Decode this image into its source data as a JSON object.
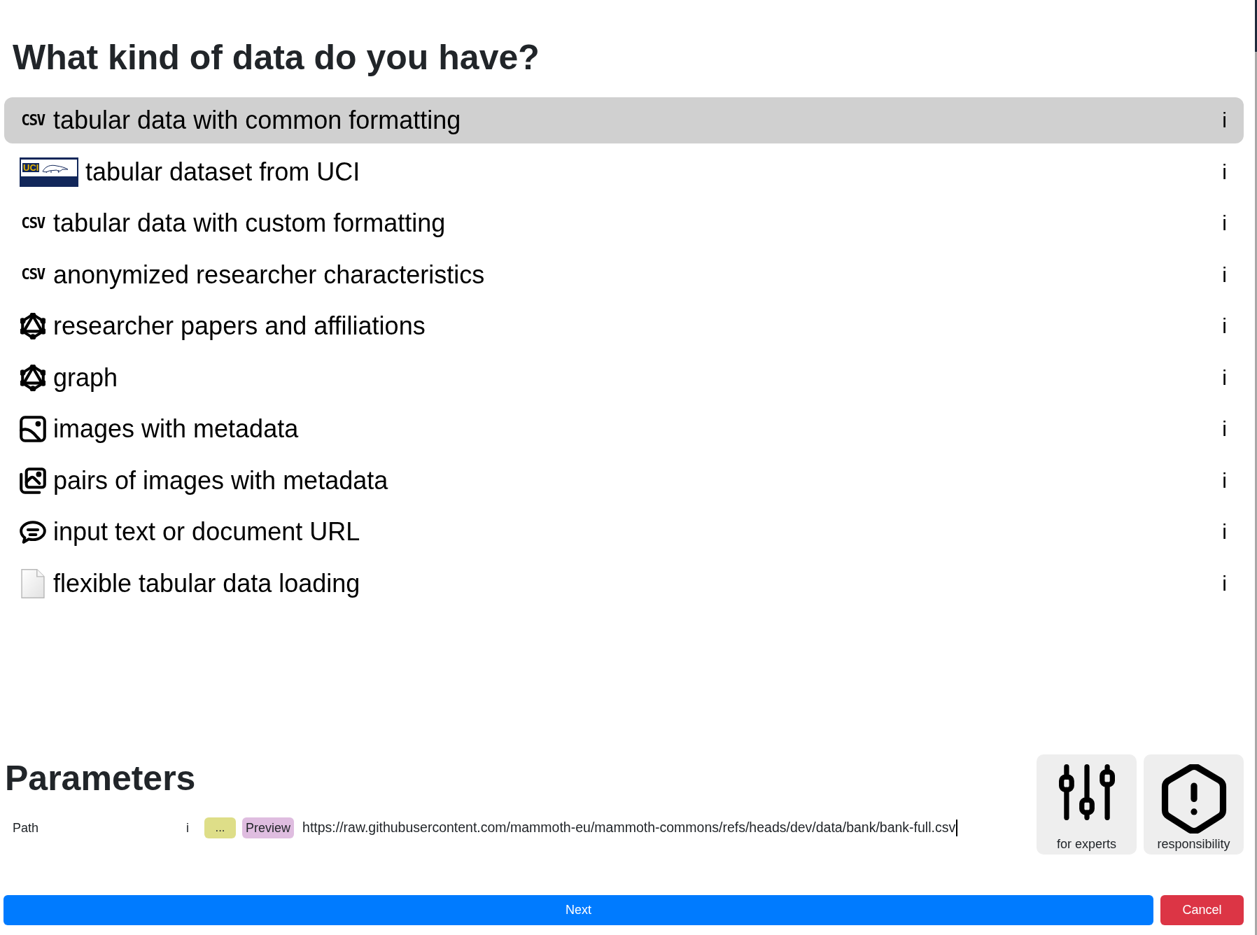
{
  "heading": "What kind of data do you have?",
  "data_types": [
    {
      "kind": "csv",
      "badge": "CSV",
      "label": "tabular data with common formatting",
      "info": "i",
      "selected": true
    },
    {
      "kind": "logo",
      "badge": "UCI",
      "label": "tabular dataset from UCI",
      "info": "i",
      "selected": false
    },
    {
      "kind": "csv",
      "badge": "CSV",
      "label": "tabular data with custom formatting",
      "info": "i",
      "selected": false
    },
    {
      "kind": "csv",
      "badge": "CSV",
      "label": "anonymized researcher characteristics",
      "info": "i",
      "selected": false
    },
    {
      "kind": "graph",
      "label": "researcher papers and affiliations",
      "info": "i",
      "selected": false
    },
    {
      "kind": "graph",
      "label": "graph",
      "info": "i",
      "selected": false
    },
    {
      "kind": "image",
      "label": "images with metadata",
      "info": "i",
      "selected": false
    },
    {
      "kind": "image_pair",
      "label": "pairs of images with metadata",
      "info": "i",
      "selected": false
    },
    {
      "kind": "text",
      "label": "input text or document URL",
      "info": "i",
      "selected": false
    },
    {
      "kind": "file",
      "label": "flexible tabular data loading",
      "info": "i",
      "selected": false
    }
  ],
  "parameters": {
    "heading": "Parameters",
    "fields": [
      {
        "label": "Path",
        "info": "i",
        "browse_button": "...",
        "preview_button": "Preview",
        "value": "https://raw.githubusercontent.com/mammoth-eu/mammoth-commons/refs/heads/dev/data/bank/bank-full.csv"
      }
    ]
  },
  "option_cards": [
    {
      "kind": "sliders",
      "label": "for experts"
    },
    {
      "kind": "alert",
      "label": "responsibility"
    }
  ],
  "actions": [
    {
      "kind": "primary",
      "label": "Next"
    },
    {
      "kind": "danger",
      "label": "Cancel"
    }
  ]
}
